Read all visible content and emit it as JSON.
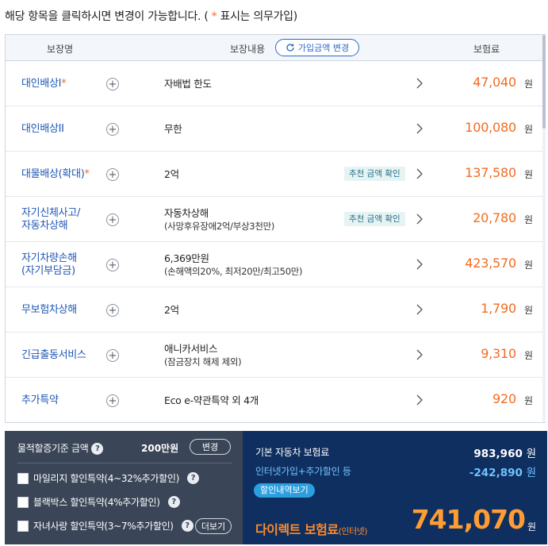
{
  "notice": {
    "prefix": "해당 항목을 클릭하시면 변경이 가능합니다. ( ",
    "star": "*",
    "suffix": " 표시는 의무가입)"
  },
  "table": {
    "headers": {
      "name": "보장명",
      "coverage": "보장내용",
      "premium": "보험료"
    },
    "change_button": "가입금액 변경",
    "unit": "원",
    "rows": [
      {
        "name": "대인배상I",
        "required": "*",
        "coverage": "자배법 한도",
        "sub": "",
        "recommend": "",
        "amount": "47,040"
      },
      {
        "name": "대인배상II",
        "required": "",
        "coverage": "무한",
        "sub": "",
        "recommend": "",
        "amount": "100,080"
      },
      {
        "name": "대물배상(확대)",
        "required": "*",
        "coverage": "2억",
        "sub": "",
        "recommend": "추천 금액 확인",
        "amount": "137,580"
      },
      {
        "name": "자기신체사고/\n자동차상해",
        "required": "",
        "coverage": "자동차상해",
        "sub": "(사망후유장애2억/부상3천만)",
        "recommend": "추천 금액 확인",
        "amount": "20,780"
      },
      {
        "name": "자기차량손해\n(자기부담금)",
        "required": "",
        "coverage": "6,369만원",
        "sub": "(손해액의20%, 최저20만/최고50만)",
        "recommend": "",
        "amount": "423,570"
      },
      {
        "name": "무보험차상해",
        "required": "",
        "coverage": "2억",
        "sub": "",
        "recommend": "",
        "amount": "1,790"
      },
      {
        "name": "긴급출동서비스",
        "required": "",
        "coverage": "애니카서비스",
        "sub": "(잠금장치 해제 제외)",
        "recommend": "",
        "amount": "9,310"
      },
      {
        "name": "추가특약",
        "required": "",
        "coverage": "Eco e-약관특약 외 4개",
        "sub": "",
        "recommend": "",
        "amount": "920"
      }
    ]
  },
  "bottom_left": {
    "property_label": "물적할증기준 금액",
    "property_value": "200만원",
    "change_button": "변경",
    "checks": [
      {
        "label": "마일리지 할인특약(4~32%추가할인)",
        "help": true
      },
      {
        "label": "블랙박스 할인특약(4%추가할인)",
        "help": true
      },
      {
        "label": "자녀사랑 할인특약(3~7%추가할인)",
        "help": true
      }
    ],
    "more_button": "더보기"
  },
  "bottom_right": {
    "base_label": "기본 자동차 보험료",
    "base_value": "983,960",
    "discount_label": "인터넷가입+추가할인 등",
    "discount_value": "-242,890",
    "unit": "원",
    "detail_button": "할인내역보기",
    "final_label": "다이렉트 보험료",
    "final_label_small": "(인터넷)",
    "final_value": "741,070"
  },
  "colors": {
    "accent": "#f26b21",
    "link": "#1f56b5",
    "panel_left": "#3a4657",
    "panel_right": "#0f2f60",
    "discount": "#6fc3ff"
  }
}
